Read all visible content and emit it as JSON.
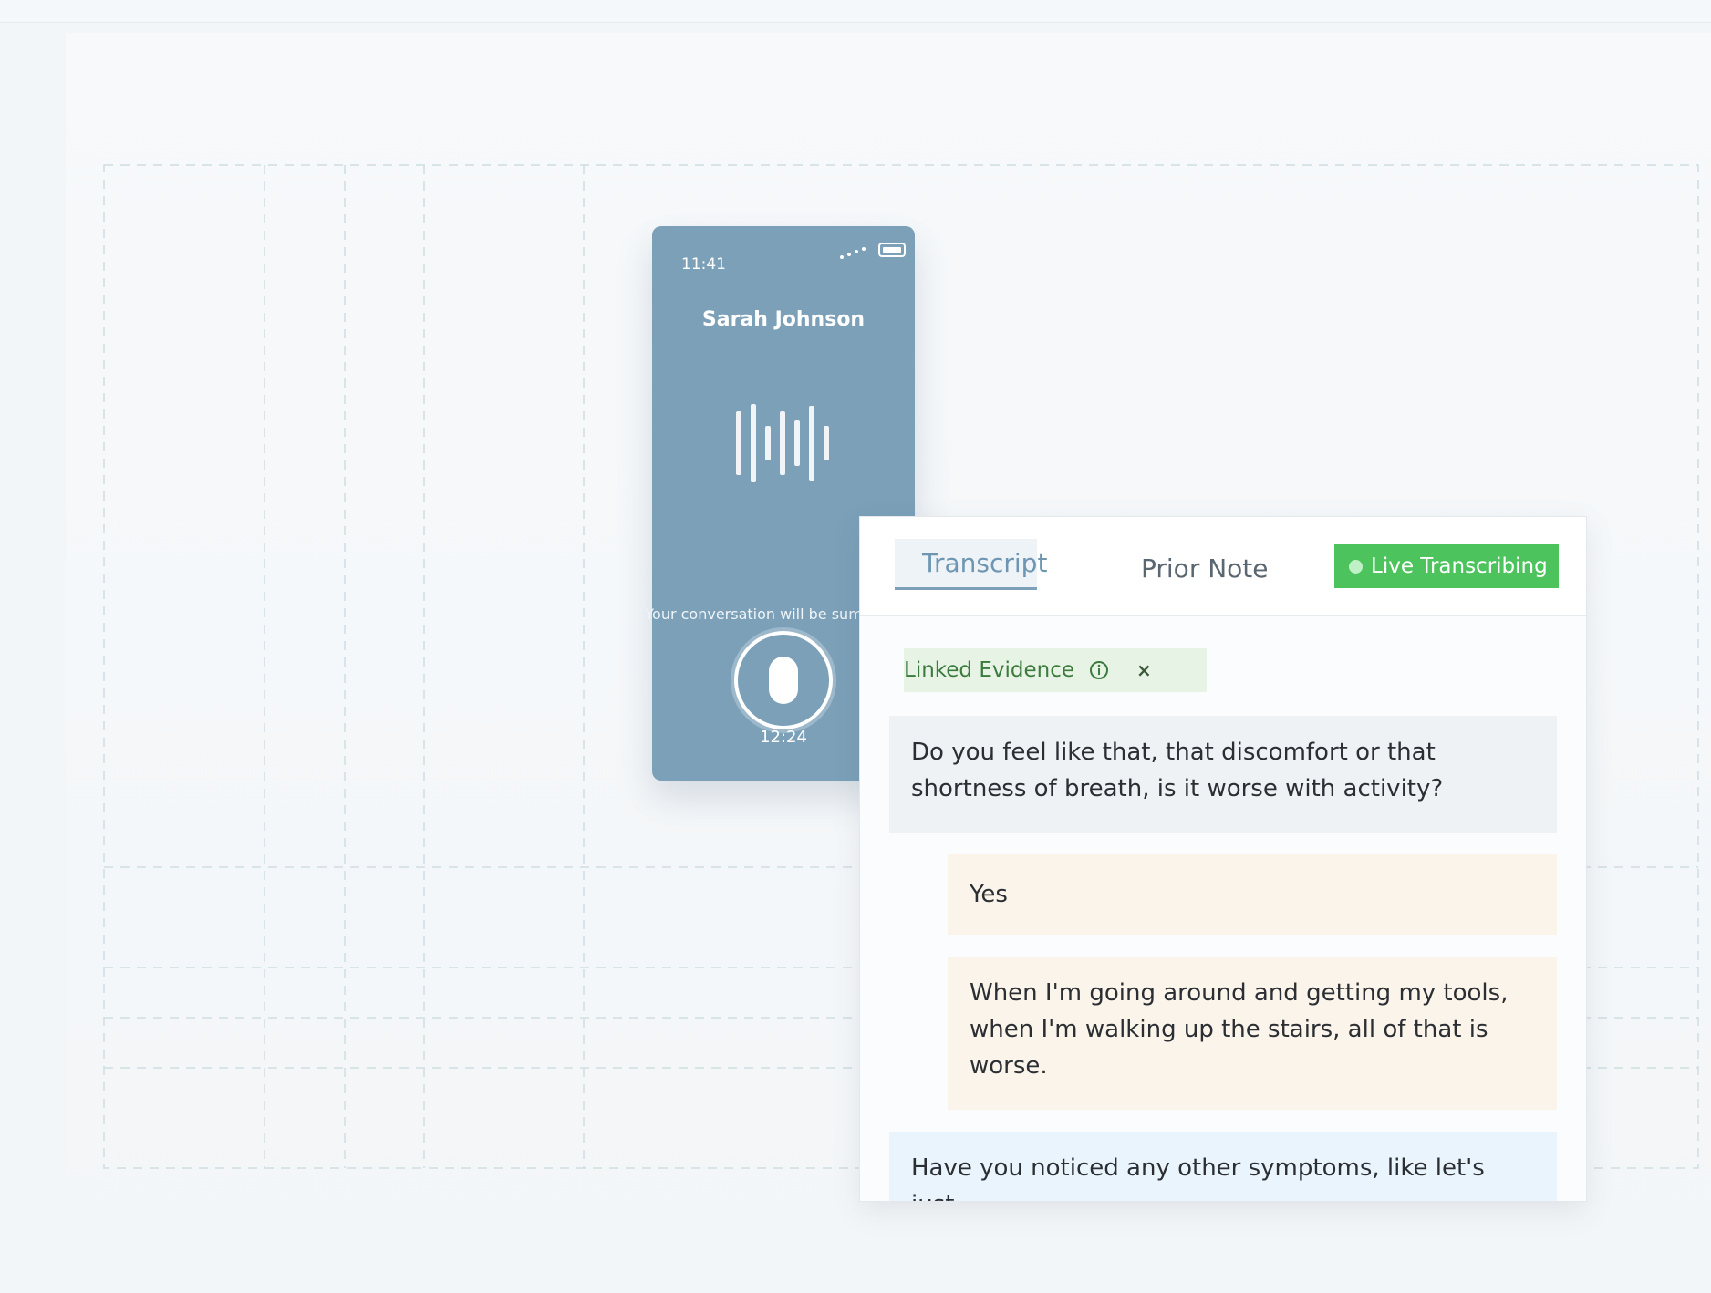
{
  "phone": {
    "time": "11:41",
    "contact_name": "Sarah Johnson",
    "summary_notice": "Your conversation will be summarized",
    "timer": "12:24",
    "icons": [
      "signal-icon",
      "battery-icon",
      "waveform-icon",
      "microphone-icon"
    ]
  },
  "panel": {
    "tabs": [
      {
        "label": "Transcript",
        "icon": "document-icon",
        "active": true
      },
      {
        "label": "Prior Note",
        "active": false
      }
    ],
    "status_badge": "Live Transcribing",
    "linked_evidence": {
      "label": "Linked Evidence",
      "icon": "info-icon",
      "close": "×"
    },
    "messages": [
      {
        "speaker": "clinician",
        "text": "Do you feel like that, that discomfort or that shortness of breath, is it worse with activity?"
      },
      {
        "speaker": "patient",
        "text": "Yes"
      },
      {
        "speaker": "patient",
        "text": "When I'm going around and getting my tools, when I'm walking up the stairs, all of that is worse."
      },
      {
        "speaker": "clinician",
        "text": "Have you noticed any other symptoms, like let's just"
      }
    ]
  },
  "colors": {
    "phone_bg": "#7ba0b8",
    "live_green": "#4cc35c",
    "evidence_bg": "#e7f4e5",
    "patient_bubble": "#fbf4ea",
    "clinician_bubble": "#eff2f5"
  }
}
